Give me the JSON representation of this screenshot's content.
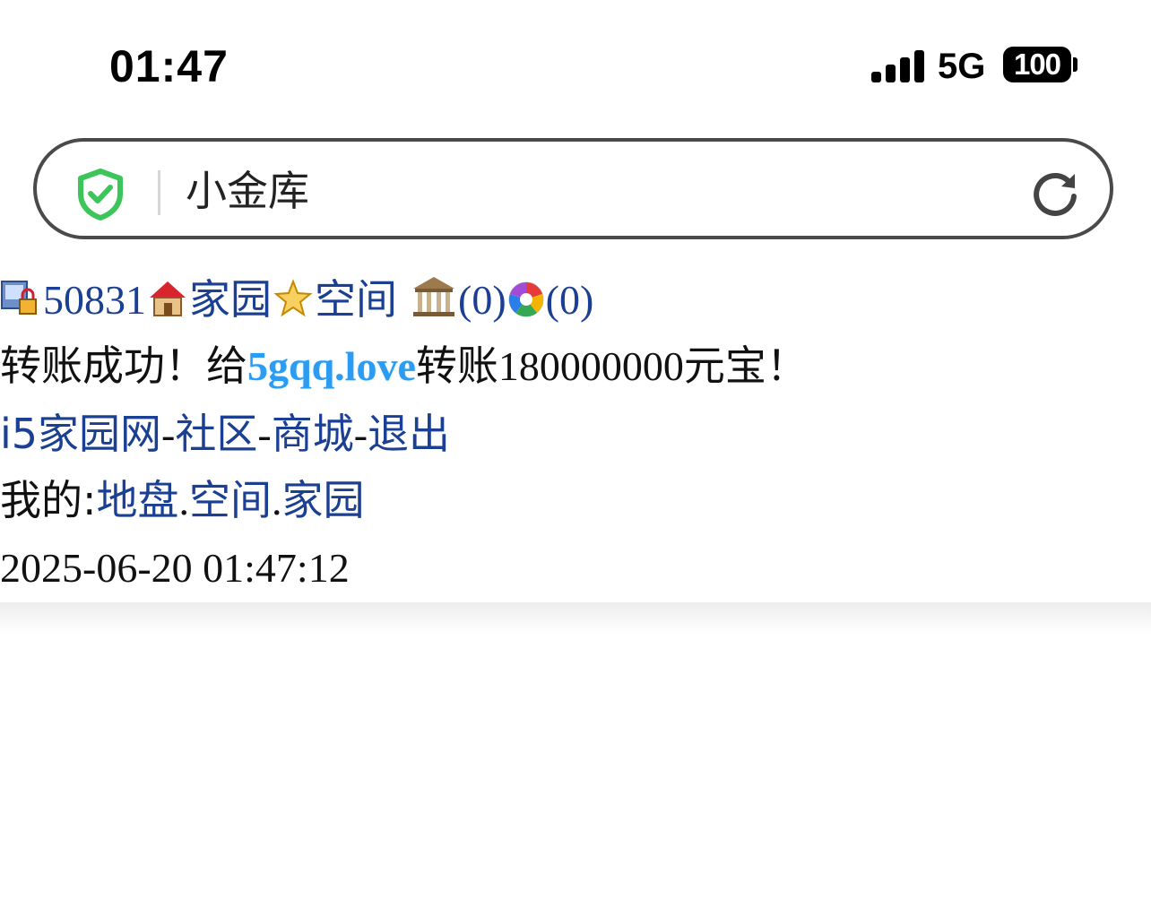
{
  "status_bar": {
    "time": "01:47",
    "network": "5G",
    "battery": "100"
  },
  "address_bar": {
    "title": "小金库"
  },
  "nav": {
    "user_id": "50831",
    "home_label": "家园",
    "space_label": "空间",
    "bank_count": "(0)",
    "album_count": "(0)"
  },
  "message": {
    "prefix": "转账成功！给",
    "recipient": "5gqq.love",
    "middle": "转账",
    "amount": "180000000",
    "suffix": "元宝！"
  },
  "links": {
    "site": "i5家园网",
    "community": "社区",
    "mall": "商城",
    "logout": "退出",
    "sep": "-"
  },
  "mine": {
    "label": "我的:",
    "land": "地盘",
    "space": "空间",
    "home": "家园",
    "dot": "."
  },
  "timestamp": "2025-06-20 01:47:12",
  "colors": {
    "link": "#1a3f93",
    "highlight": "#2b9cf2",
    "shield": "#3cc65a"
  }
}
